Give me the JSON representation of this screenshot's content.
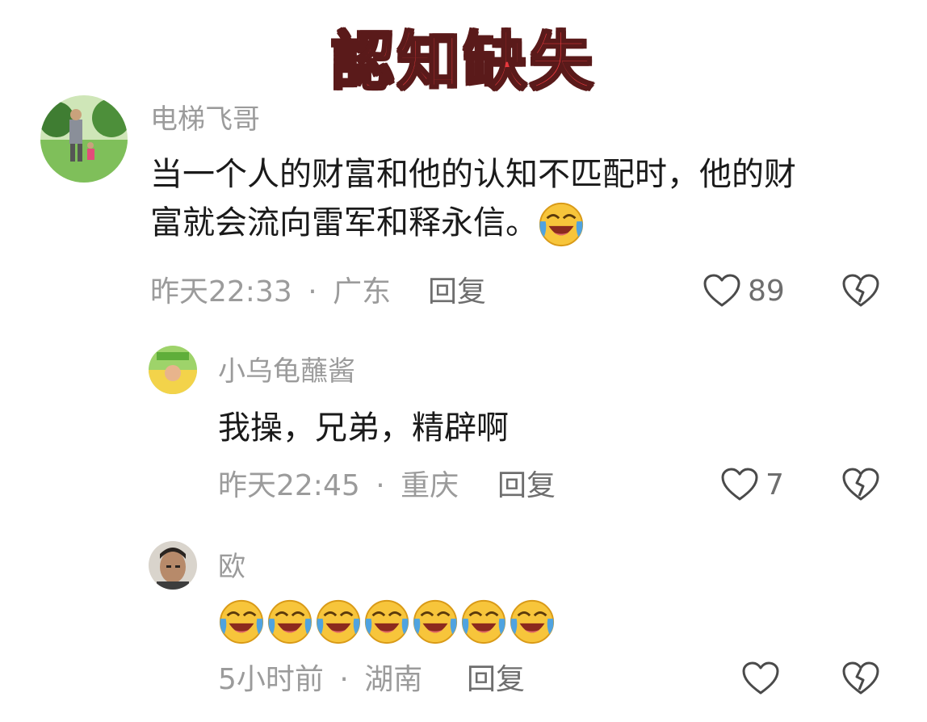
{
  "title": "認知缺失",
  "comments": [
    {
      "username": "电梯飞哥",
      "text_line1": "当一个人的财富和他的认知不匹配时，他的财",
      "text_line2": "富就会流向雷军和释永信。",
      "emoji": "laughing-crying-emoji",
      "time": "昨天22:33",
      "location": "广东",
      "reply_label": "回复",
      "likes": "89"
    },
    {
      "username": "小乌龟蘸酱",
      "text": "我操，兄弟，精辟啊",
      "time": "昨天22:45",
      "location": "重庆",
      "reply_label": "回复",
      "likes": "7"
    },
    {
      "username": "欧",
      "emoji": "laughing-crying-emoji",
      "emoji_count": 7,
      "time": "5小时前",
      "location": "湖南",
      "reply_label": "回复",
      "likes": ""
    }
  ],
  "separator": "·",
  "colors": {
    "title": "#e8383d",
    "meta": "#9b9b9b",
    "text": "#1a1a1a"
  }
}
